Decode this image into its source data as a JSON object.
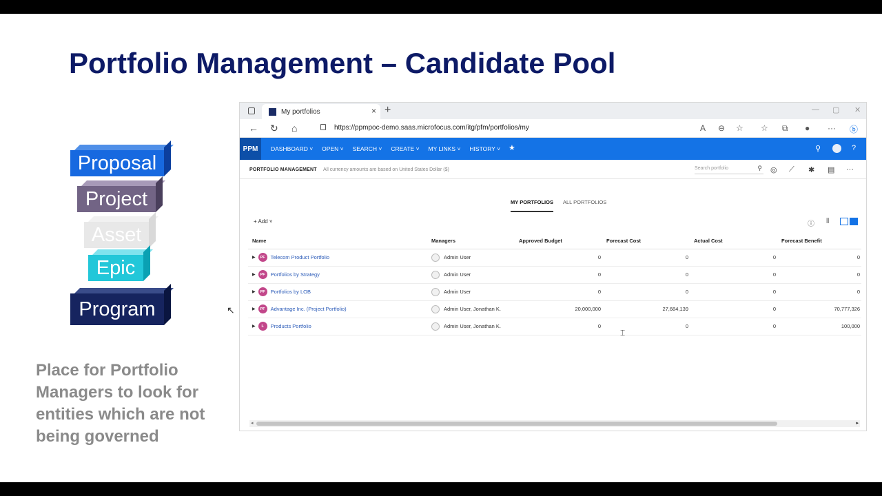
{
  "slide": {
    "title": "Portfolio Management – Candidate Pool",
    "description": "Place for Portfolio Managers to look for entities which are not being governed",
    "blocks": [
      "Proposal",
      "Project",
      "Asset",
      "Epic",
      "Program"
    ]
  },
  "browser": {
    "tab_title": "My portfolios",
    "url": "https://ppmpoc-demo.saas.microfocus.com/itg/pfm/portfolios/my"
  },
  "app": {
    "logo": "PPM",
    "menu": [
      "DASHBOARD",
      "OPEN",
      "SEARCH",
      "CREATE",
      "MY LINKS",
      "HISTORY"
    ],
    "section_title": "PORTFOLIO MANAGEMENT",
    "currency_note": "All currency amounts are based on United States Dollar ($)",
    "search_placeholder": "Search portfolio",
    "tabs": [
      "MY PORTFOLIOS",
      "ALL PORTFOLIOS"
    ],
    "add_label": "Add",
    "columns": [
      "Name",
      "Managers",
      "Approved Budget",
      "Forecast Cost",
      "Actual Cost",
      "Forecast Benefit"
    ],
    "rows": [
      {
        "badge": "PF",
        "name": "Telecom Product Portfolio",
        "managers": "Admin User",
        "approved_budget": "0",
        "forecast_cost": "0",
        "actual_cost": "0",
        "forecast_benefit": "0"
      },
      {
        "badge": "PF",
        "name": "Portfolios by Strategy",
        "managers": "Admin User",
        "approved_budget": "0",
        "forecast_cost": "0",
        "actual_cost": "0",
        "forecast_benefit": "0"
      },
      {
        "badge": "PF",
        "name": "Portfolios by LOB",
        "managers": "Admin User",
        "approved_budget": "0",
        "forecast_cost": "0",
        "actual_cost": "0",
        "forecast_benefit": "0"
      },
      {
        "badge": "PF",
        "name": "Advantage Inc. (Project Portfolio)",
        "managers": "Admin User, Jonathan K.",
        "approved_budget": "20,000,000",
        "forecast_cost": "27,684,139",
        "actual_cost": "0",
        "forecast_benefit": "70,777,326"
      },
      {
        "badge": "L",
        "name": "Products Portfolio",
        "managers": "Admin User, Jonathan K.",
        "approved_budget": "0",
        "forecast_cost": "0",
        "actual_cost": "0",
        "forecast_benefit": "100,000"
      }
    ]
  },
  "colors": {
    "title": "#0d1a66",
    "app_bar": "#1473e6",
    "badge": "#c2478a",
    "link": "#2b5bb8"
  }
}
